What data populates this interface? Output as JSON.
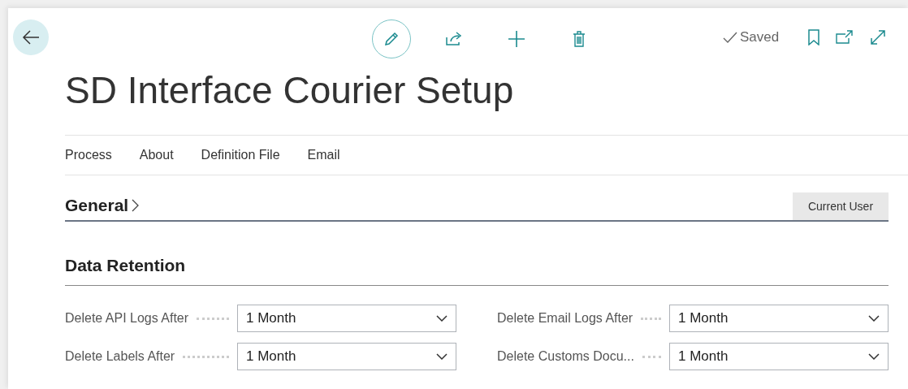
{
  "toolbar": {
    "status": "Saved"
  },
  "title": "SD Interface Courier Setup",
  "actions": [
    {
      "label": "Process"
    },
    {
      "label": "About"
    },
    {
      "label": "Definition File"
    },
    {
      "label": "Email"
    }
  ],
  "sections": [
    {
      "title": "General",
      "expanded": false,
      "button": "Current User"
    },
    {
      "title": "Data Retention",
      "expanded": true,
      "columns": [
        [
          {
            "label": "Delete API Logs After",
            "value": "1 Month"
          },
          {
            "label": "Delete Labels After",
            "value": "1 Month"
          }
        ],
        [
          {
            "label": "Delete Email Logs After",
            "value": "1 Month"
          },
          {
            "label": "Delete Customs Docu...",
            "value": "1 Month"
          }
        ]
      ]
    }
  ]
}
